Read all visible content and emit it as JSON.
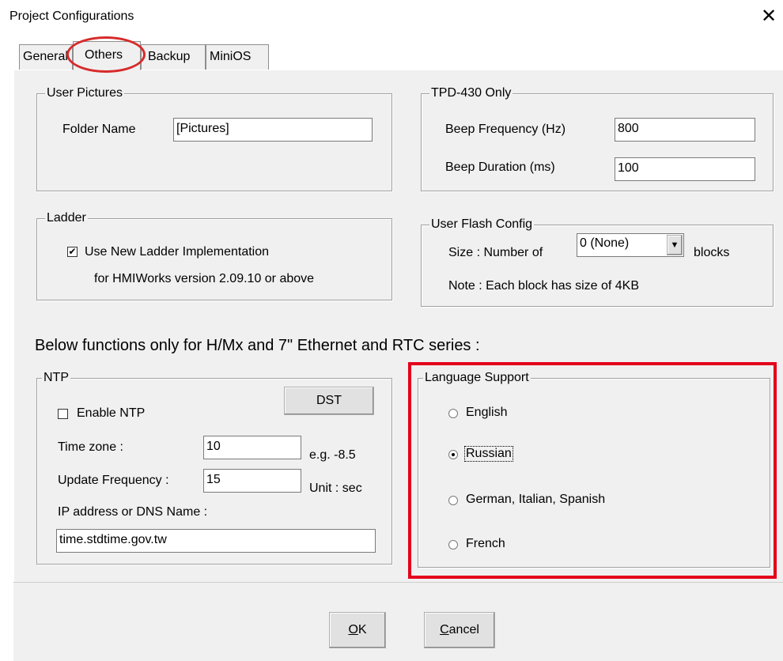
{
  "window": {
    "title": "Project Configurations",
    "close_glyph": "✕"
  },
  "tabs": [
    {
      "label": "General"
    },
    {
      "label": "Others"
    },
    {
      "label": "Backup"
    },
    {
      "label": "MiniOS"
    }
  ],
  "user_pictures": {
    "legend": "User Pictures",
    "folder_label": "Folder Name",
    "folder_value": "[Pictures]"
  },
  "tpd": {
    "legend": "TPD-430 Only",
    "freq_label": "Beep Frequency (Hz)",
    "freq_value": "800",
    "dur_label": "Beep Duration (ms)",
    "dur_value": "100"
  },
  "ladder": {
    "legend": "Ladder",
    "checkbox_label": "Use New Ladder Implementation",
    "checked": true,
    "note": "for HMIWorks version 2.09.10 or above"
  },
  "flash": {
    "legend": "User Flash Config",
    "size_label": "Size :  Number of",
    "select_value": "0 (None)",
    "unit": "blocks",
    "note": "Note : Each block has size of 4KB"
  },
  "section_heading": "Below functions only for H/Mx and 7\" Ethernet and RTC series :",
  "ntp": {
    "legend": "NTP",
    "enable_label": "Enable NTP",
    "enabled": false,
    "dst_label": "DST",
    "tz_label": "Time zone :",
    "tz_value": "10",
    "tz_hint": "e.g. -8.5",
    "freq_label": "Update Frequency :",
    "freq_value": "15",
    "freq_unit": "Unit : sec",
    "ip_label": "IP address or DNS Name :",
    "ip_value": "time.stdtime.gov.tw"
  },
  "language": {
    "legend": "Language Support",
    "options": [
      {
        "label": "English",
        "selected": false
      },
      {
        "label": "Russian",
        "selected": true
      },
      {
        "label": "German, Italian, Spanish",
        "selected": false
      },
      {
        "label": "French",
        "selected": false
      }
    ]
  },
  "buttons": {
    "ok": "OK",
    "cancel": "Cancel"
  },
  "colors": {
    "highlight_red": "#e3001b",
    "dialog_bg": "#f0f0f0"
  }
}
